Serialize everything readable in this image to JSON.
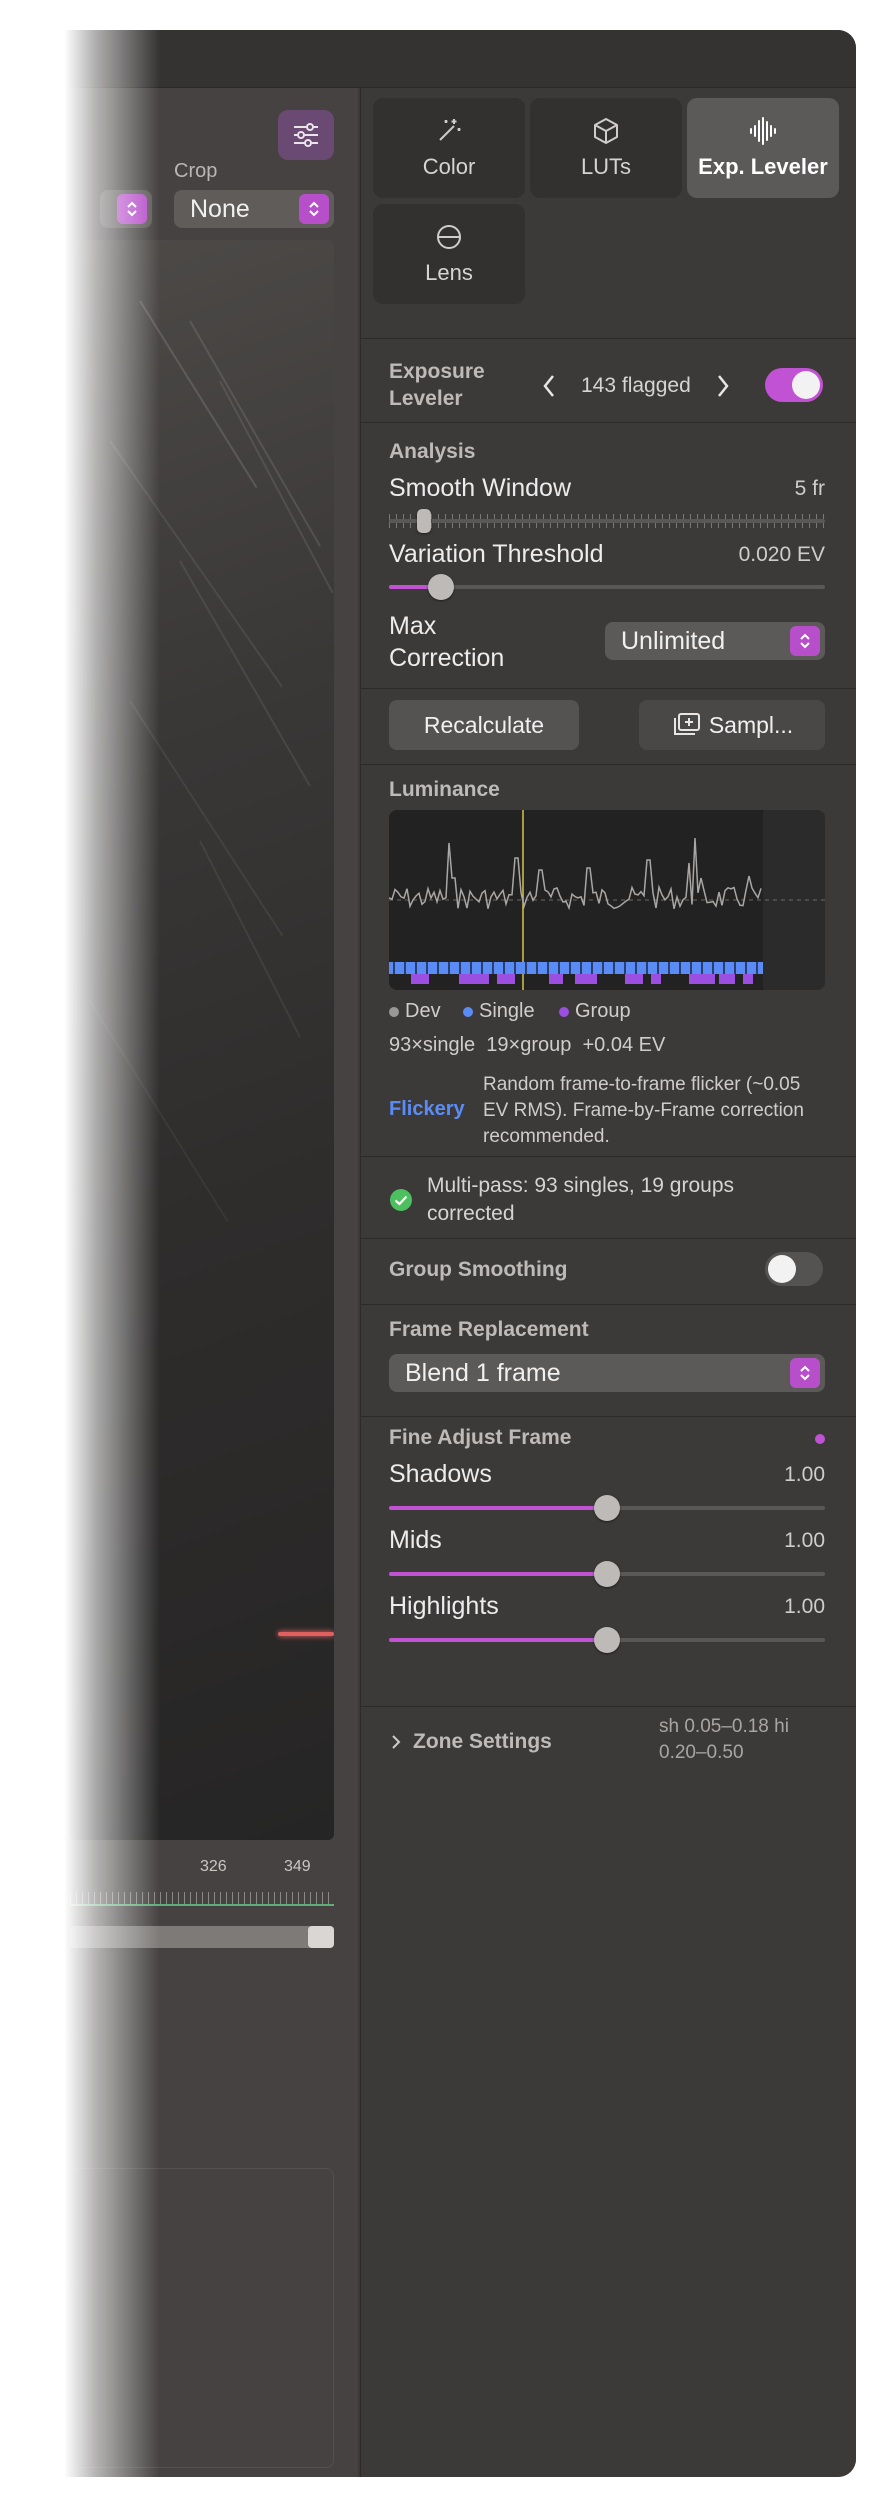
{
  "left": {
    "crop_label": "Crop",
    "crop_value": "None",
    "ruler": [
      "326",
      "349"
    ]
  },
  "tabs": [
    {
      "label": "Color",
      "icon": "sparkle-wand-icon"
    },
    {
      "label": "LUTs",
      "icon": "cube-icon"
    },
    {
      "label": "Exp. Leveler",
      "icon": "waveform-icon",
      "active": true
    },
    {
      "label": "Lens",
      "icon": "lens-icon"
    }
  ],
  "exposure": {
    "title": "Exposure Leveler",
    "flagged": "143 flagged",
    "enabled": true
  },
  "analysis": {
    "heading": "Analysis",
    "smooth_label": "Smooth Window",
    "smooth_value": "5 fr",
    "variation_label": "Variation Threshold",
    "variation_value": "0.020 EV",
    "variation_level": 0.12,
    "max_label": "Max Correction",
    "max_value": "Unlimited"
  },
  "actions": {
    "recalc": "Recalculate",
    "sample": "Sampl..."
  },
  "luminance": {
    "heading": "Luminance",
    "legend": [
      "Dev",
      "Single",
      "Group"
    ],
    "stats": "93×single  19×group  +0.04 EV",
    "tag": "Flickery",
    "description": "Random frame-to-frame flicker (~0.05 EV RMS). Frame-by-Frame correction recommended."
  },
  "status": {
    "message": "Multi-pass: 93 singles, 19 groups corrected"
  },
  "group_smoothing": {
    "label": "Group Smoothing",
    "enabled": false
  },
  "frame_replacement": {
    "heading": "Frame Replacement",
    "value": "Blend 1 frame"
  },
  "fine_adjust": {
    "heading": "Fine Adjust Frame",
    "shadows_label": "Shadows",
    "shadows_value": "1.00",
    "mids_label": "Mids",
    "mids_value": "1.00",
    "highlights_label": "Highlights",
    "highlights_value": "1.00"
  },
  "zone": {
    "label": "Zone Settings",
    "summary": "sh 0.05–0.18  hi 0.20–0.50"
  },
  "colors": {
    "accent": "#c052d3",
    "single": "#5b8cf5",
    "group": "#9b4fe0",
    "dev": "#9a9896",
    "ok": "#4cc05e",
    "link": "#5b8cf5"
  }
}
